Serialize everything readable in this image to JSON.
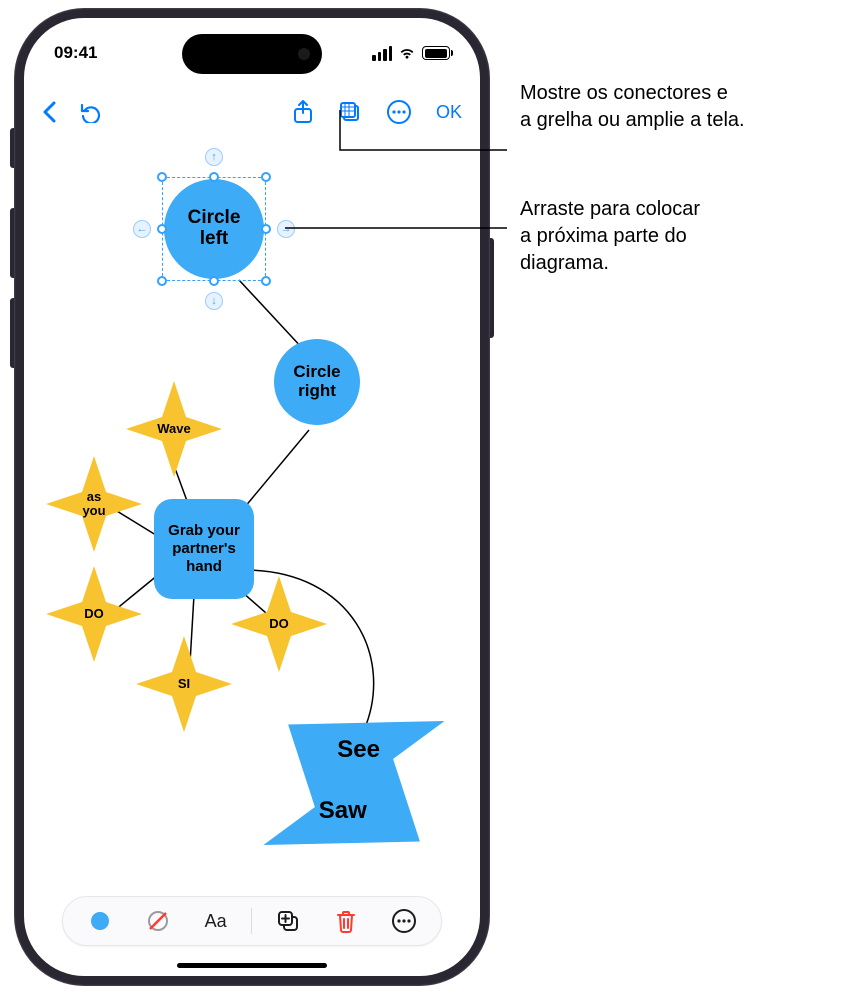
{
  "status": {
    "time": "09:41"
  },
  "toolbar": {
    "ok": "OK"
  },
  "shapes": {
    "circle_left": "Circle\nleft",
    "circle_right": "Circle\nright",
    "grab": "Grab your\npartner's\nhand",
    "star_wave": "Wave",
    "star_asyou": "as\nyou",
    "star_do_left": "DO",
    "star_do_right": "DO",
    "star_si": "SI",
    "tri_see": "See",
    "tri_saw": "Saw"
  },
  "callouts": {
    "top": "Mostre os conectores e\na grelha ou amplie a tela.",
    "mid": "Arraste para colocar\na próxima parte do\ndiagrama."
  }
}
